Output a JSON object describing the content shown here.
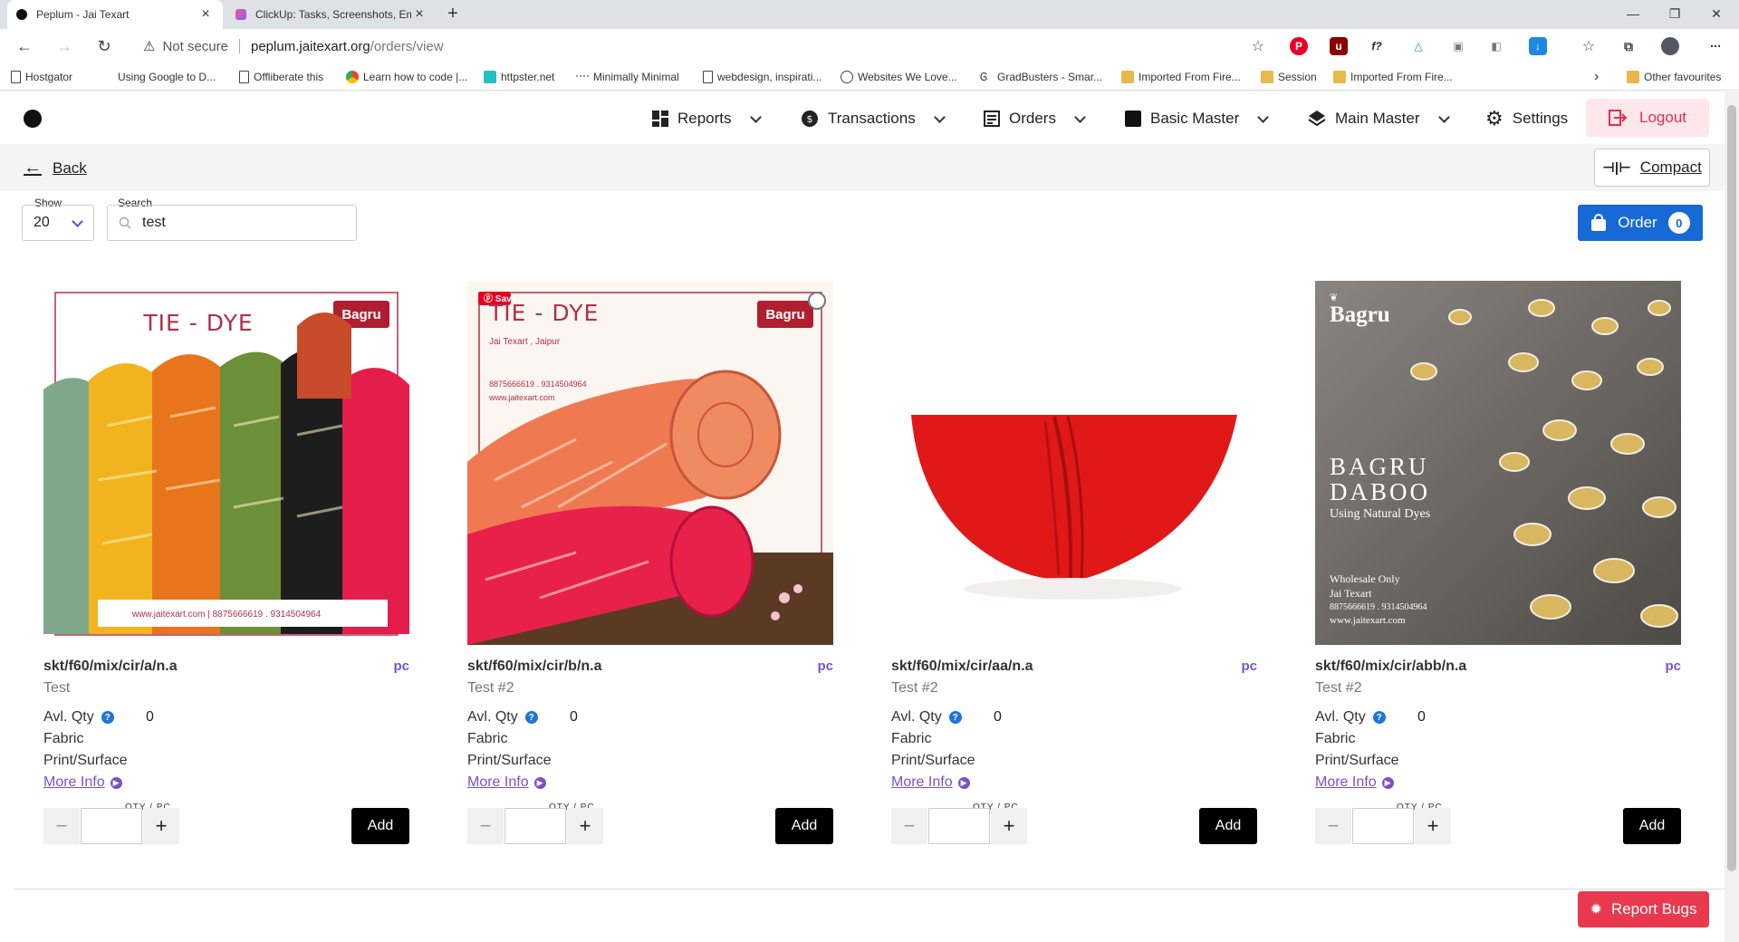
{
  "browser": {
    "tabs": [
      {
        "title": "Peplum - Jai Texart",
        "active": true
      },
      {
        "title": "ClickUp: Tasks, Screenshots, Ema",
        "active": false
      }
    ],
    "new_tab": "+",
    "window_controls": [
      "minimize",
      "restore",
      "close"
    ],
    "address": {
      "security": "Not secure",
      "domain": "peplum.jaitexart.org",
      "path": "/orders/view"
    },
    "bookmarks": [
      {
        "label": "Hostgator",
        "icon": "page-icon"
      },
      {
        "label": "Using Google to D...",
        "icon": "none"
      },
      {
        "label": "Offliberate this",
        "icon": "page-icon"
      },
      {
        "label": "Learn how to code |...",
        "icon": "chrome-icon"
      },
      {
        "label": "httpster.net",
        "icon": "httpster-icon"
      },
      {
        "label": "Minimally Minimal",
        "icon": "dots-icon"
      },
      {
        "label": "webdesign, inspirati...",
        "icon": "page-icon"
      },
      {
        "label": "Websites We Love...",
        "icon": "circle-icon"
      },
      {
        "label": "GradBusters - Smar...",
        "icon": "gb-icon"
      },
      {
        "label": "Imported From Fire...",
        "icon": "folder-icon"
      },
      {
        "label": "Session",
        "icon": "folder-icon"
      },
      {
        "label": "Imported From Fire...",
        "icon": "folder-icon"
      }
    ],
    "other_favourites": "Other favourites"
  },
  "nav": {
    "reports": "Reports",
    "transactions": "Transactions",
    "orders": "Orders",
    "basic_master": "Basic Master",
    "main_master": "Main Master",
    "settings": "Settings",
    "logout": "Logout"
  },
  "subbar": {
    "back": "Back",
    "compact": "Compact"
  },
  "controls": {
    "show_label": "Show",
    "show_value": "20",
    "search_label": "Search",
    "search_value": "test",
    "order_label": "Order",
    "order_count": "0"
  },
  "products": [
    {
      "sku": "skt/f60/mix/cir/a/n.a",
      "unit": "pc",
      "name": "Test",
      "avl_label": "Avl. Qty",
      "avl_qty": "0",
      "fabric": "Fabric",
      "surface": "Print/Surface",
      "more": "More Info",
      "qty_label": "QTY / PC",
      "add": "Add",
      "image": {
        "heading": "TIE - DYE",
        "brand": "Bagru",
        "footer": "www.jaitexart.com | 8875666619 . 9314504964"
      }
    },
    {
      "sku": "skt/f60/mix/cir/b/n.a",
      "unit": "pc",
      "name": "Test #2",
      "avl_label": "Avl. Qty",
      "avl_qty": "0",
      "fabric": "Fabric",
      "surface": "Print/Surface",
      "more": "More Info",
      "qty_label": "QTY / PC",
      "add": "Add",
      "image": {
        "heading": "TIE - DYE",
        "brand": "Bagru",
        "sub": "Jai Texart , Jaipur",
        "phone": "8875666619 . 9314504964",
        "web": "www.jaitexart.com",
        "pin": "Save"
      }
    },
    {
      "sku": "skt/f60/mix/cir/aa/n.a",
      "unit": "pc",
      "name": "Test #2",
      "avl_label": "Avl. Qty",
      "avl_qty": "0",
      "fabric": "Fabric",
      "surface": "Print/Surface",
      "more": "More Info",
      "qty_label": "QTY / PC",
      "add": "Add",
      "image": {}
    },
    {
      "sku": "skt/f60/mix/cir/abb/n.a",
      "unit": "pc",
      "name": "Test #2",
      "avl_label": "Avl. Qty",
      "avl_qty": "0",
      "fabric": "Fabric",
      "surface": "Print/Surface",
      "more": "More Info",
      "qty_label": "QTY / PC",
      "add": "Add",
      "image": {
        "brand": "Bagru",
        "title1": "BAGRU",
        "title2": "DABOO",
        "tagline": "Using Natural Dyes",
        "w1": "Wholesale Only",
        "w2": "Jai Texart",
        "w3": "8875666619 . 9314504964",
        "w4": "www.jaitexart.com"
      }
    }
  ],
  "report_bugs": "Report Bugs",
  "colors": {
    "accent_purple": "#7a52c7",
    "order_blue": "#1769d6",
    "logout_red": "#e0314c",
    "report_red": "#e8394f"
  }
}
